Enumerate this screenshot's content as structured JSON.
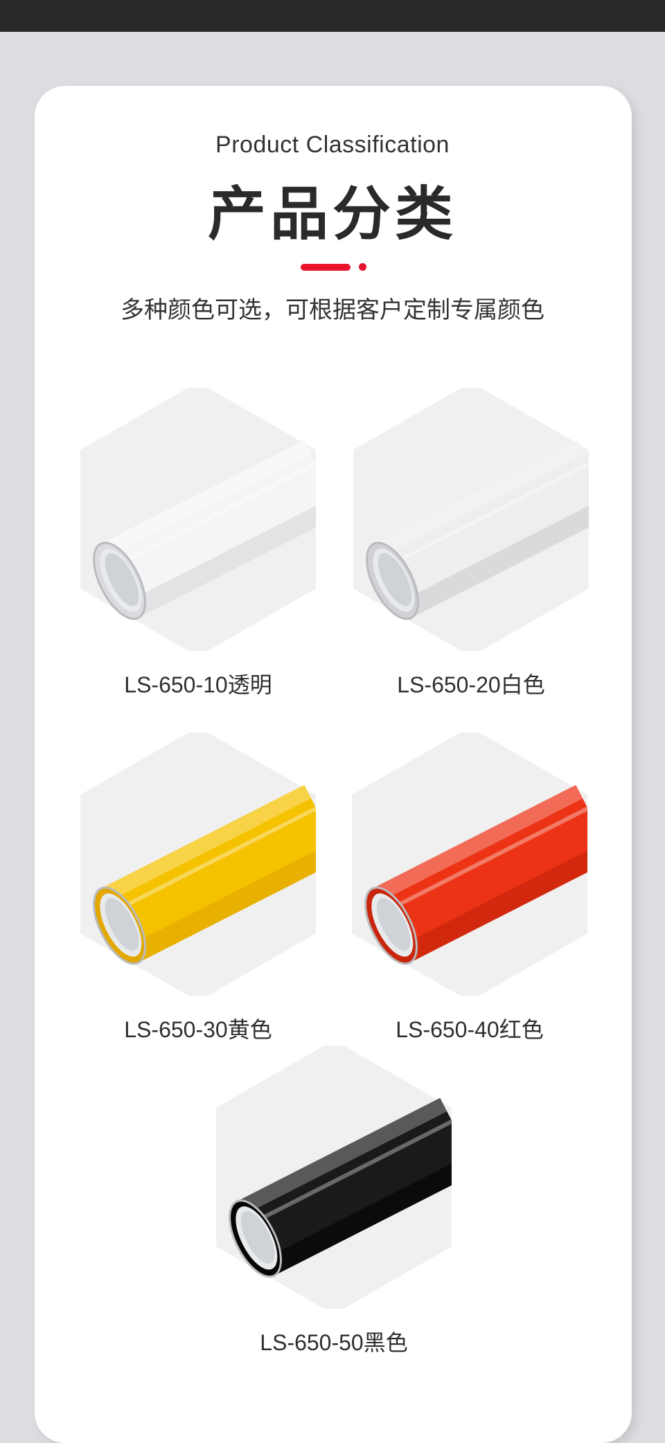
{
  "header": {
    "subtitle_en": "Product Classification",
    "title_cn": "产品分类",
    "description": "多种颜色可选，可根据客户定制专属颜色",
    "divider_color": "#e8122d"
  },
  "products": [
    {
      "label": "LS-650-10透明",
      "color": "#f4f5f6",
      "shade": "#d9dbde",
      "icon": "transparent-film-roll-icon"
    },
    {
      "label": "LS-650-20白色",
      "color": "#eeeeef",
      "shade": "#cfd1d4",
      "icon": "white-film-roll-icon"
    },
    {
      "label": "LS-650-30黄色",
      "color": "#f5c200",
      "shade": "#e2a800",
      "icon": "yellow-film-roll-icon"
    },
    {
      "label": "LS-650-40红色",
      "color": "#ec3315",
      "shade": "#c8250c",
      "icon": "red-film-roll-icon"
    },
    {
      "label": "LS-650-50黑色",
      "color": "#1a1a1a",
      "shade": "#050505",
      "icon": "black-film-roll-icon"
    }
  ]
}
